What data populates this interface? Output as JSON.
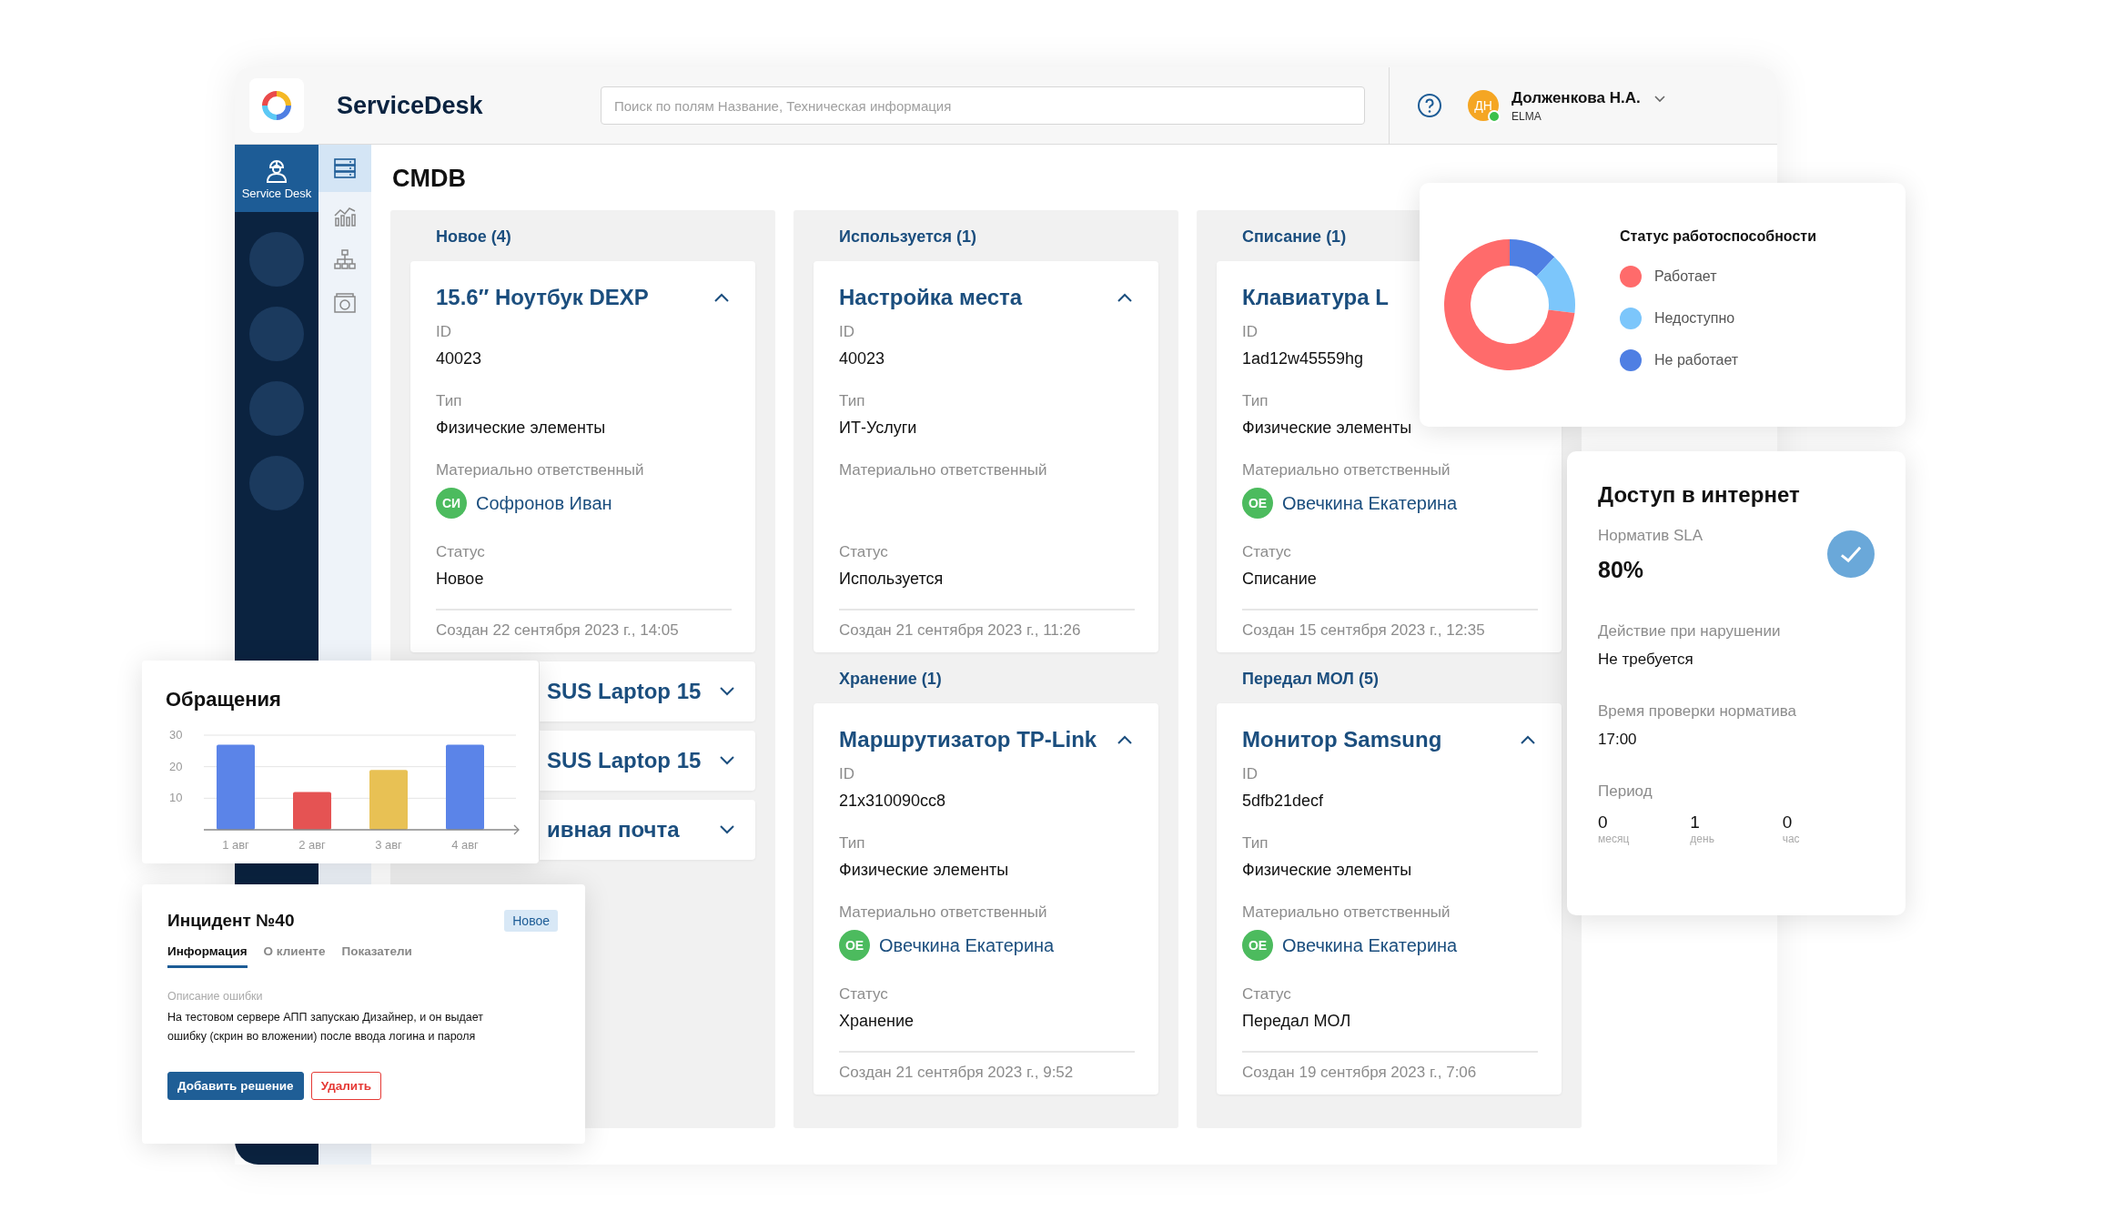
{
  "header": {
    "app_name": "ServiceDesk",
    "search": {
      "placeholder": "Поиск по полям Название, Техническая информация"
    },
    "user": {
      "initials": "ДН",
      "name": "Долженкова Н.А.",
      "org": "ELMA",
      "online": true
    }
  },
  "sidebar": {
    "items": [
      {
        "label": "Service Desk",
        "selected": true
      }
    ]
  },
  "rail": {
    "items": [
      {
        "kind": "servers",
        "selected": true
      },
      {
        "kind": "chart",
        "selected": false
      },
      {
        "kind": "hierarchy",
        "selected": false
      },
      {
        "kind": "camera",
        "selected": false
      }
    ]
  },
  "page": {
    "title": "CMDB"
  },
  "columns": [
    {
      "groups": [
        {
          "title": "Новое (4)",
          "cards": [
            {
              "title": "15.6″ Ноутбук DEXP",
              "expanded": true,
              "fields": [
                {
                  "label": "ID",
                  "value": "40023"
                },
                {
                  "label": "Тип",
                  "value": "Физические элементы"
                },
                {
                  "label": "Материально ответственный",
                  "kind": "person",
                  "initials": "СИ",
                  "value": "Софронов Иван"
                },
                {
                  "label": "Статус",
                  "value": "Новое"
                }
              ],
              "created": "Создан 22 сентября 2023 г., 14:05"
            },
            {
              "title": "SUS Laptop 15",
              "expanded": false
            },
            {
              "title": "SUS Laptop 15",
              "expanded": false
            },
            {
              "title": "ивная почта",
              "expanded": false
            }
          ]
        }
      ]
    },
    {
      "groups": [
        {
          "title": "Используется (1)",
          "cards": [
            {
              "title": "Настройка места",
              "expanded": true,
              "fields": [
                {
                  "label": "ID",
                  "value": "40023"
                },
                {
                  "label": "Тип",
                  "value": "ИТ-Услуги"
                },
                {
                  "label": "Материально ответственный",
                  "kind": "person"
                },
                {
                  "label": "Статус",
                  "value": "Используется"
                }
              ],
              "created": "Создан 21 сентября 2023 г., 11:26"
            }
          ]
        },
        {
          "title": "Хранение (1)",
          "cards": [
            {
              "title": "Маршрутизатор TP-Link",
              "expanded": true,
              "fields": [
                {
                  "label": "ID",
                  "value": "21x310090cc8"
                },
                {
                  "label": "Тип",
                  "value": "Физические элементы"
                },
                {
                  "label": "Материально ответственный",
                  "kind": "person",
                  "initials": "ОЕ",
                  "value": "Овечкина Екатерина"
                },
                {
                  "label": "Статус",
                  "value": "Хранение"
                }
              ],
              "created": "Создан 21 сентября 2023 г., 9:52"
            }
          ]
        }
      ]
    },
    {
      "groups": [
        {
          "title": "Списание (1)",
          "cards": [
            {
              "title": "Клавиатура L",
              "fields": [
                {
                  "label": "ID",
                  "value": "1ad12w45559hg"
                },
                {
                  "label": "Тип",
                  "value": "Физические элементы"
                },
                {
                  "label": "Материально ответственный",
                  "kind": "person",
                  "initials": "ОЕ",
                  "value": "Овечкина Екатерина"
                },
                {
                  "label": "Статус",
                  "value": "Списание"
                }
              ],
              "created": "Создан 15 сентября 2023 г., 12:35"
            }
          ]
        },
        {
          "title": "Передал МОЛ (5)",
          "cards": [
            {
              "title": "Монитор Samsung",
              "expanded": true,
              "fields": [
                {
                  "label": "ID",
                  "value": "5dfb21decf"
                },
                {
                  "label": "Тип",
                  "value": "Физические элементы"
                },
                {
                  "label": "Материально ответственный",
                  "kind": "person",
                  "initials": "ОЕ",
                  "value": "Овечкина Екатерина"
                },
                {
                  "label": "Статус",
                  "value": "Передал МОЛ"
                }
              ],
              "created": "Создан 19 сентября 2023 г., 7:06"
            }
          ]
        }
      ]
    }
  ],
  "donut_card": {
    "legend_title": "Статус работоспособности",
    "legend": [
      {
        "label": "Работает",
        "color": "#ff6b6b"
      },
      {
        "label": "Недоступно",
        "color": "#7cc6fb"
      },
      {
        "label": "Не работает",
        "color": "#4f7fe3"
      }
    ]
  },
  "sla_card": {
    "title": "Доступ в интернет",
    "sla_label": "Норматив SLA",
    "sla_value": "80%",
    "met": true,
    "fields": [
      {
        "label": "Действие при нарушении",
        "value": "Не требуется"
      },
      {
        "label": "Время проверки норматива",
        "value": "17:00"
      }
    ],
    "period_label": "Период",
    "period": [
      {
        "value": "0",
        "unit": "месяц"
      },
      {
        "value": "1",
        "unit": "день"
      },
      {
        "value": "0",
        "unit": "час"
      }
    ]
  },
  "requests_card": {
    "title": "Обращения",
    "chart_data": {
      "type": "bar",
      "categories": [
        "1 авг",
        "2 авг",
        "3 авг",
        "4 авг"
      ],
      "values": [
        27,
        12,
        19,
        27
      ],
      "ylim": [
        0,
        30
      ],
      "yticks": [
        10,
        20,
        30
      ]
    }
  },
  "incident_card": {
    "title": "Инцидент №40",
    "status": "Новое",
    "tabs": [
      {
        "label": "Информация",
        "selected": true
      },
      {
        "label": "О клиенте",
        "selected": false
      },
      {
        "label": "Показатели",
        "selected": false
      }
    ],
    "description_label": "Описание ошибки",
    "description": "На тестовом сервере АПП запускаю Дизайнер, и он выдает ошибку (скрин во вложении) после ввода логина и пароля",
    "buttons": [
      {
        "label": "Добавить решение",
        "kind": "primary"
      },
      {
        "label": "Удалить",
        "kind": "danger"
      }
    ]
  }
}
